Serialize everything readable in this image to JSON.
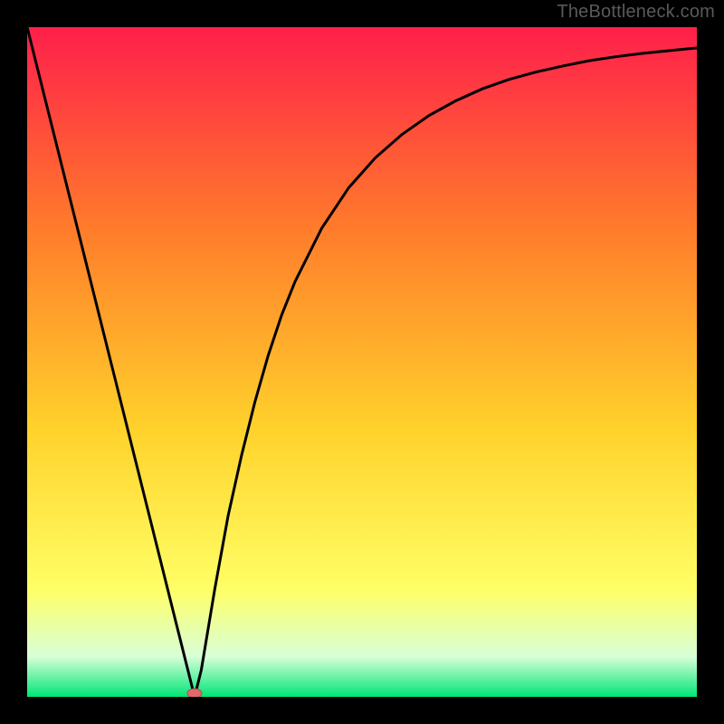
{
  "attribution": "TheBottleneck.com",
  "colors": {
    "frame": "#000000",
    "grad_top": "#ff1f4b",
    "grad_mid_upper": "#ff7b2b",
    "grad_mid": "#ffd22b",
    "grad_lower": "#ffff66",
    "grad_near_bottom": "#d8ffd8",
    "grad_bottom": "#00e676",
    "curve": "#000000",
    "marker_fill": "#e06a6a",
    "marker_stroke": "#b94a4a"
  },
  "chart_data": {
    "type": "line",
    "title": "",
    "xlabel": "",
    "ylabel": "",
    "xlim": [
      0,
      100
    ],
    "ylim": [
      0,
      100
    ],
    "series": [
      {
        "name": "bottleneck-curve",
        "x": [
          0,
          2,
          4,
          6,
          8,
          10,
          12,
          14,
          16,
          18,
          20,
          22,
          24,
          25,
          26,
          27,
          28,
          30,
          32,
          34,
          36,
          38,
          40,
          44,
          48,
          52,
          56,
          60,
          64,
          68,
          72,
          76,
          80,
          84,
          88,
          92,
          96,
          100
        ],
        "values": [
          100,
          92,
          84,
          76,
          68,
          60,
          52,
          44,
          36,
          28,
          20,
          12,
          4,
          0,
          4,
          10,
          16,
          27,
          36,
          44,
          51,
          57,
          62,
          70,
          76,
          80.5,
          84,
          86.8,
          89,
          90.8,
          92.2,
          93.3,
          94.2,
          95,
          95.6,
          96.1,
          96.5,
          96.9
        ]
      }
    ],
    "marker": {
      "x": 25,
      "y": 0
    },
    "gradient_stops": [
      {
        "offset": 0.0,
        "color_key": "grad_top"
      },
      {
        "offset": 0.3,
        "color_key": "grad_mid_upper"
      },
      {
        "offset": 0.6,
        "color_key": "grad_mid"
      },
      {
        "offset": 0.84,
        "color_key": "grad_lower"
      },
      {
        "offset": 0.94,
        "color_key": "grad_near_bottom"
      },
      {
        "offset": 1.0,
        "color_key": "grad_bottom"
      }
    ]
  }
}
